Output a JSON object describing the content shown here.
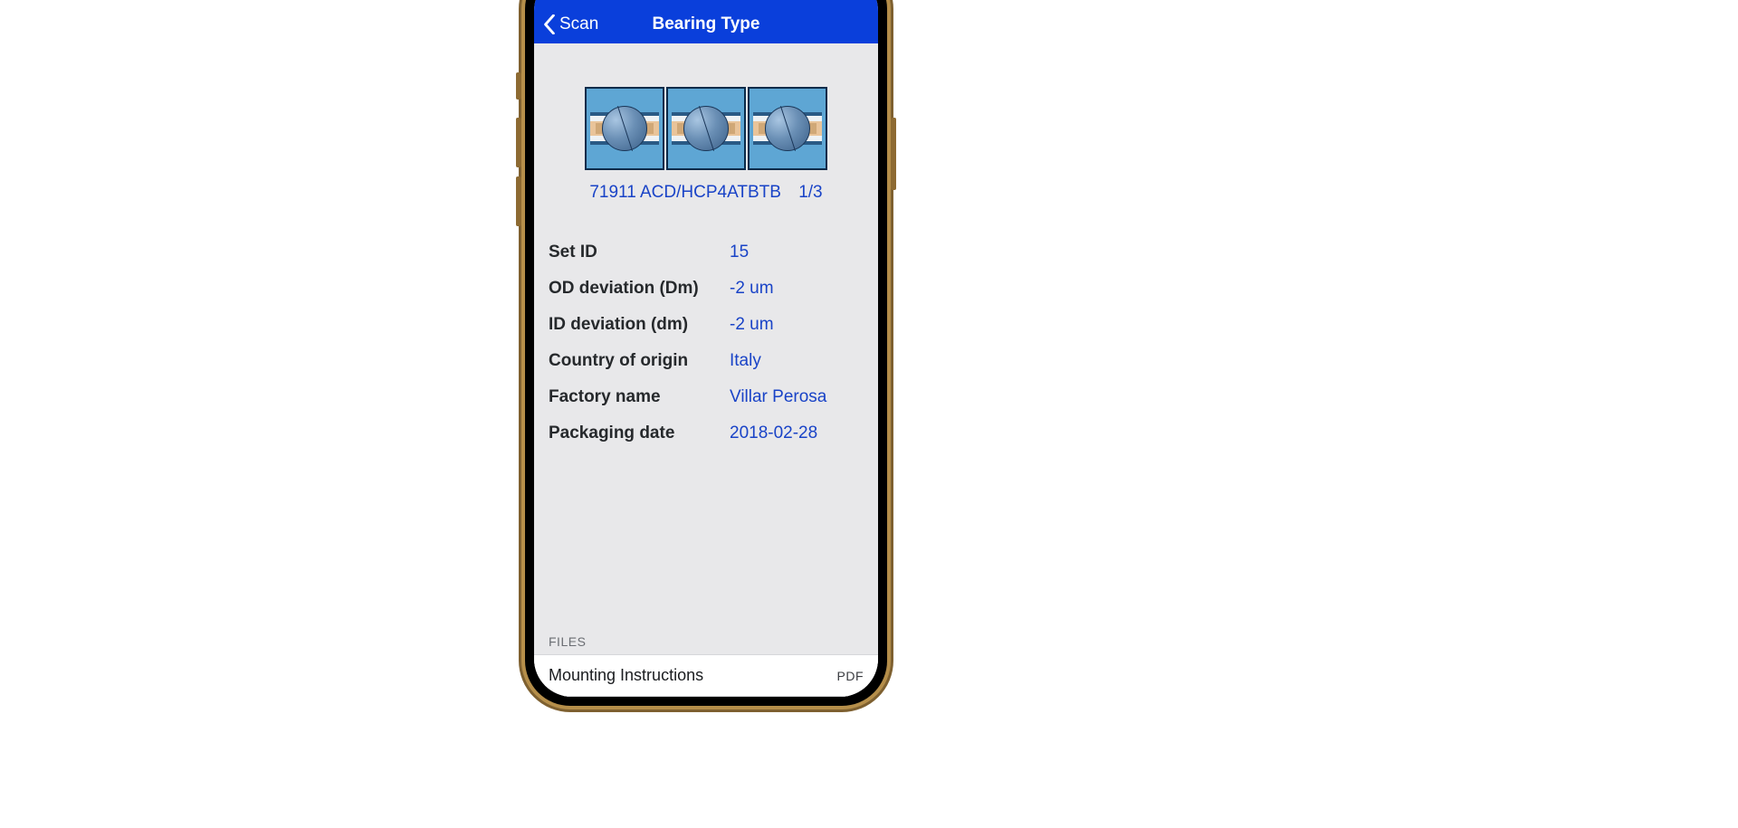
{
  "nav": {
    "back_label": "Scan",
    "title": "Bearing Type"
  },
  "product": {
    "designation": "71911 ACD/HCP4ATBTB",
    "index": "1/3"
  },
  "specs": [
    {
      "label": "Set ID",
      "value": "15"
    },
    {
      "label": "OD deviation (Dm)",
      "value": "-2 um"
    },
    {
      "label": "ID deviation (dm)",
      "value": "-2 um"
    },
    {
      "label": "Country of origin",
      "value": "Italy"
    },
    {
      "label": "Factory name",
      "value": "Villar Perosa"
    },
    {
      "label": "Packaging date",
      "value": "2018-02-28"
    }
  ],
  "files": {
    "section_label": "FILES",
    "items": [
      {
        "name": "Mounting Instructions",
        "type": "PDF"
      }
    ]
  }
}
